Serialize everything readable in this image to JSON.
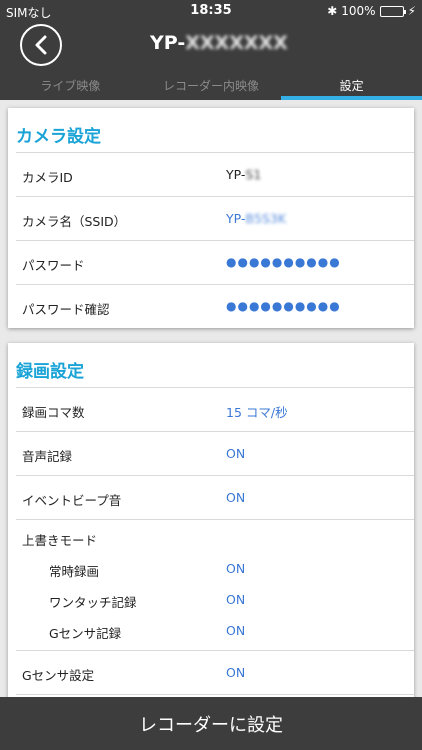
{
  "status": {
    "carrier": "SIMなし",
    "time": "18:35",
    "battery": "100%",
    "icons": [
      "wifi-icon",
      "bluetooth-icon",
      "battery-icon",
      "charging-icon"
    ]
  },
  "nav": {
    "title": "YP-",
    "title_suffix": "XXXXXXX",
    "back_icon": "chevron-left-icon"
  },
  "tabs": [
    "ライブ映像",
    "レコーダー内映像",
    "設定"
  ],
  "camera": {
    "title": "カメラ設定",
    "rows": [
      {
        "label": "カメラID",
        "value": "YP-",
        "suffix": "S1"
      },
      {
        "label": "カメラ名（SSID）",
        "value": "YP-",
        "suffix": "B5S3K"
      },
      {
        "label": "パスワード",
        "value": "●●●●●●●●●●"
      },
      {
        "label": "パスワード確認",
        "value": "●●●●●●●●●●"
      }
    ]
  },
  "recording": {
    "title": "録画設定",
    "rows": [
      {
        "label": "録画コマ数",
        "value": "15 コマ/秒"
      },
      {
        "label": "音声記録",
        "value": "ON"
      },
      {
        "label": "イベントビープ音",
        "value": "ON"
      }
    ],
    "overwrite": {
      "label": "上書きモード",
      "items": [
        {
          "label": "常時録画",
          "value": "ON"
        },
        {
          "label": "ワンタッチ記録",
          "value": "ON"
        },
        {
          "label": "Gセンサ記録",
          "value": "ON"
        }
      ]
    },
    "gsensor": {
      "label": "Gセンサ設定",
      "value": "ON"
    }
  },
  "bottom": {
    "button": "レコーダーに設定"
  },
  "colors": {
    "accent": "#34b0e6",
    "title": "#1aa3d6",
    "value": "#3a78d6",
    "dark": "#3d3d3d"
  }
}
